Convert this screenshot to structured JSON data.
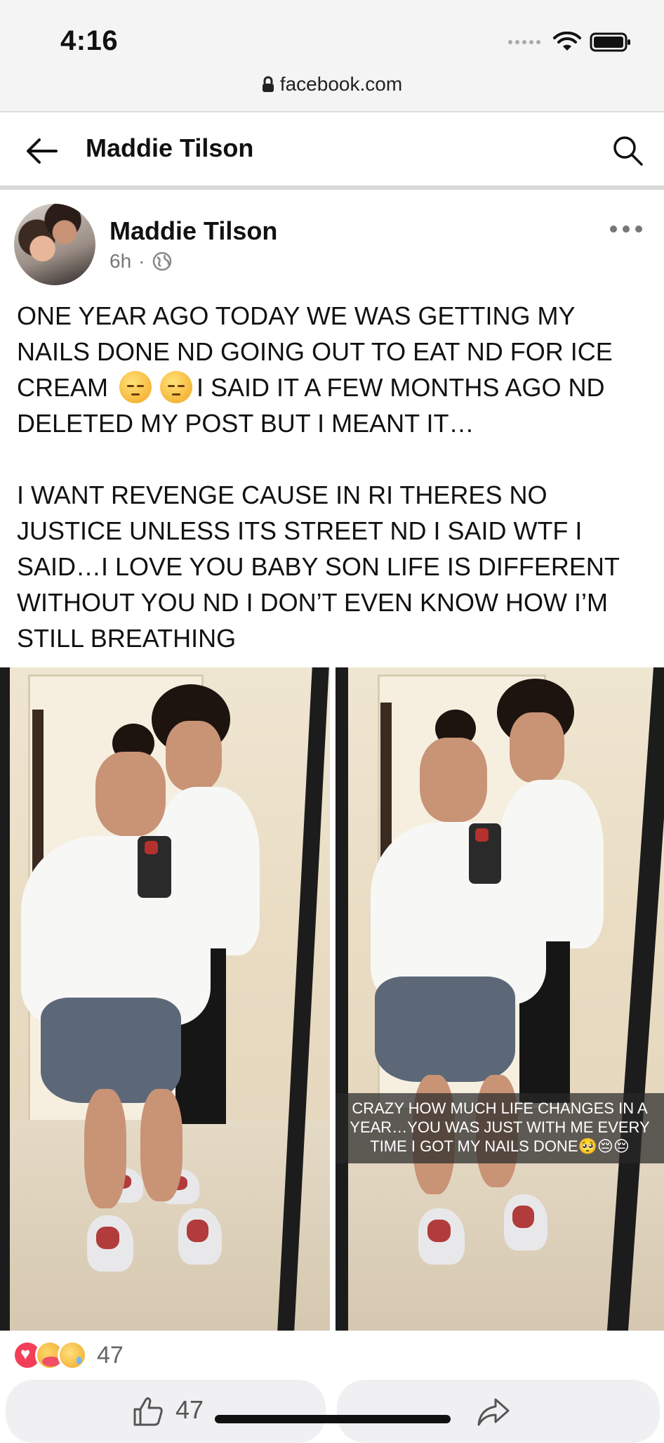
{
  "status_bar": {
    "time": "4:16",
    "url": "facebook.com"
  },
  "header": {
    "title": "Maddie Tilson"
  },
  "post": {
    "author": "Maddie Tilson",
    "time": "6h",
    "separator": "·",
    "audience_icon": "globe-icon",
    "paragraph1_part1": "ONE YEAR AGO TODAY WE WAS GETTING MY NAILS DONE ND GOING OUT TO EAT ND FOR ICE CREAM",
    "paragraph1_part2": "I SAID IT A FEW MONTHS AGO ND DELETED MY POST BUT I MEANT IT…",
    "paragraph2": "I WANT REVENGE CAUSE IN RI THERES NO JUSTICE UNLESS ITS STREET ND I SAID WTF I SAID…I LOVE YOU BABY SON LIFE IS DIFFERENT WITHOUT YOU ND I DON’T EVEN KNOW HOW I’M STILL BREATHING",
    "photo_caption": "CRAZY HOW MUCH LIFE CHANGES IN A YEAR…YOU WAS JUST WITH ME EVERY TIME I GOT MY NAILS DONE🥺😔😔"
  },
  "reactions": {
    "types": [
      "love",
      "care",
      "sad"
    ],
    "count": "47"
  },
  "actions": {
    "like_count": "47"
  },
  "colors": {
    "love": "#f33e58",
    "chrome_bg": "#f4f4f4"
  }
}
